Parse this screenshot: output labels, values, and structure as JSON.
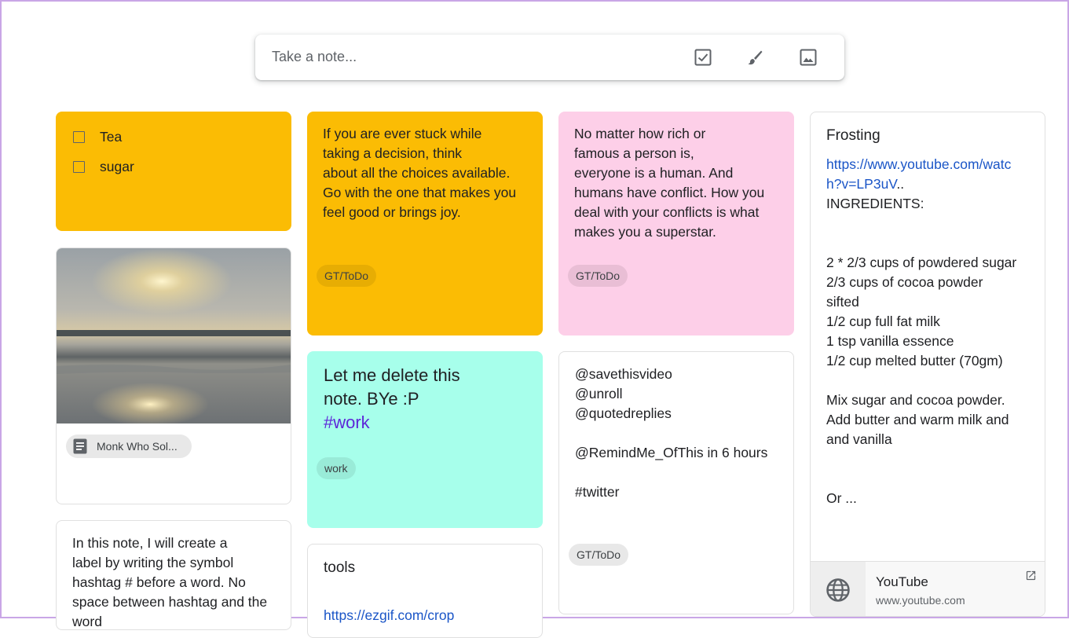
{
  "take_note": {
    "placeholder": "Take a note...",
    "icons": [
      "checkbox-icon",
      "brush-icon",
      "image-icon"
    ]
  },
  "colors": {
    "yellow": "#fbbc04",
    "pink": "#fdcfe8",
    "teal": "#a7ffeb",
    "white": "#ffffff"
  },
  "notes": {
    "checklist": {
      "items": [
        "Tea",
        "sugar"
      ]
    },
    "image_note": {
      "attachment_label": "Monk Who Sol..."
    },
    "hashtag_note": {
      "text": "In this note, I will create a\nlabel by writing the symbol\nhashtag # before a word. No\nspace between hashtag and the\nword"
    },
    "stuck_note": {
      "text": "If you are ever stuck while\ntaking a decision, think\nabout all the choices available.\nGo with the one that makes you\nfeel good or brings joy.",
      "label": "GT/ToDo"
    },
    "delete_note": {
      "line1": "Let me delete this",
      "line2": "note. BYe :P",
      "hashtag": "#work",
      "label": "work"
    },
    "tools_note": {
      "title": "tools",
      "link": "https://ezgif.com/crop"
    },
    "rich_note": {
      "text": "No matter how rich or\nfamous a person is,\neveryone is a human. And\nhumans have conflict. How you\ndeal with your conflicts is what\nmakes you a superstar.",
      "label": "GT/ToDo"
    },
    "twitter_note": {
      "text": "@savethisvideo\n@unroll\n@quotedreplies\n\n@RemindMe_OfThis in 6 hours\n\n#twitter",
      "label": "GT/ToDo"
    },
    "frosting_note": {
      "title": "Frosting",
      "link_line1": "https://www.youtube.com/watc",
      "link_line2": "h?v=LP3uV",
      "link_suffix": "..",
      "text": "INGREDIENTS:\n\n\n2 * 2/3 cups of powdered sugar\n2/3 cups of cocoa powder\nsifted\n1/2 cup full fat milk\n1 tsp vanilla essence\n1/2 cup melted butter (70gm)\n\nMix sugar and cocoa powder.\nAdd butter and warm milk and\nand vanilla\n\n\nOr ...",
      "preview_title": "YouTube",
      "preview_domain": "www.youtube.com"
    }
  }
}
